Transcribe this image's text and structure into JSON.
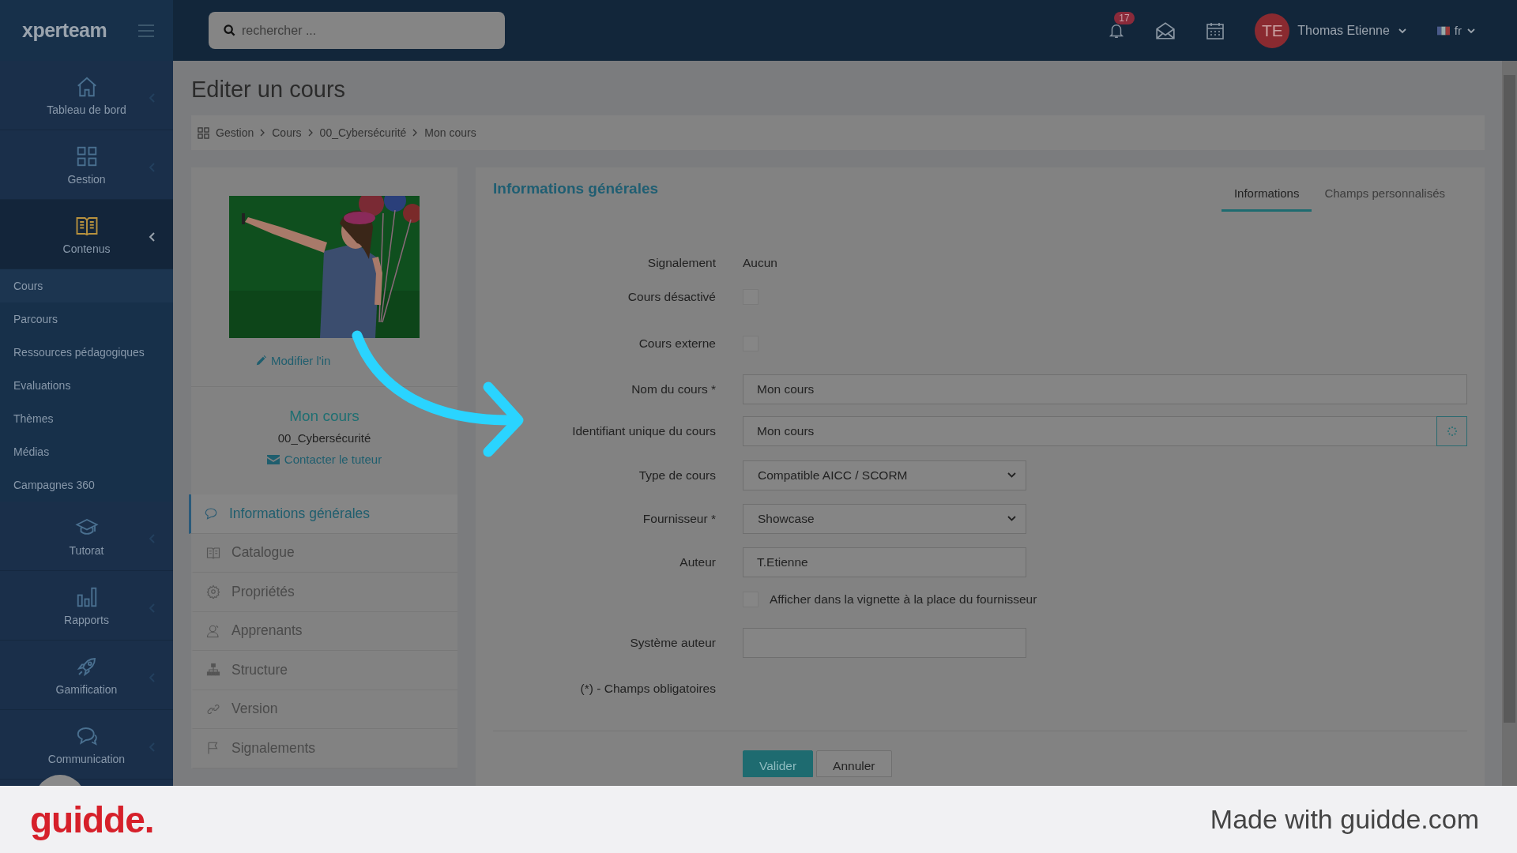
{
  "topbar": {
    "logo": "xperteam",
    "search": {
      "placeholder": "rechercher ..."
    },
    "notifications": "17",
    "user": {
      "initials": "TE",
      "name": "Thomas Etienne"
    },
    "language": "fr"
  },
  "sidebar": {
    "sections": [
      {
        "label": "Tableau de bord",
        "expanded": false
      },
      {
        "label": "Gestion",
        "expanded": false
      },
      {
        "label": "Contenus",
        "expanded": true,
        "children": [
          {
            "label": "Cours",
            "selected": true
          },
          {
            "label": "Parcours",
            "selected": false
          },
          {
            "label": "Ressources pédagogiques",
            "selected": false
          },
          {
            "label": "Evaluations",
            "selected": false
          },
          {
            "label": "Thèmes",
            "selected": false
          },
          {
            "label": "Médias",
            "selected": false
          },
          {
            "label": "Campagnes 360",
            "selected": false
          }
        ]
      },
      {
        "label": "Tutorat",
        "expanded": false
      },
      {
        "label": "Rapports",
        "expanded": false
      },
      {
        "label": "Gamification",
        "expanded": false
      },
      {
        "label": "Communication",
        "expanded": false
      }
    ]
  },
  "page": {
    "title": "Editer un cours",
    "breadcrumb": [
      "Gestion",
      "Cours",
      "00_Cybersécurité",
      "Mon cours"
    ]
  },
  "course_card": {
    "edit_image": "Modifier l'in",
    "name": "Mon cours",
    "theme": "00_Cybersécurité",
    "contact": "Contacter le tuteur",
    "menu": [
      {
        "label": "Informations générales",
        "selected": true
      },
      {
        "label": "Catalogue",
        "selected": false
      },
      {
        "label": "Propriétés",
        "selected": false
      },
      {
        "label": "Apprenants",
        "selected": false
      },
      {
        "label": "Structure",
        "selected": false
      },
      {
        "label": "Version",
        "selected": false
      },
      {
        "label": "Signalements",
        "selected": false
      }
    ]
  },
  "form": {
    "title": "Informations générales",
    "tabs": [
      {
        "label": "Informations",
        "selected": true
      },
      {
        "label": "Champs personnalisés",
        "selected": false
      }
    ],
    "rows": [
      {
        "kind": "text",
        "label": "Signalement",
        "value": "Aucun"
      },
      {
        "kind": "checkbox",
        "label": "Cours désactivé",
        "checked": false
      },
      {
        "kind": "checkbox",
        "label": "Cours externe",
        "checked": false
      },
      {
        "kind": "input",
        "label": "Nom du cours *",
        "value": "Mon cours"
      },
      {
        "kind": "input_button",
        "label": "Identifiant unique du cours",
        "value": "Mon cours"
      },
      {
        "kind": "select",
        "label": "Type de cours",
        "value": "Compatible AICC / SCORM"
      },
      {
        "kind": "select",
        "label": "Fournisseur *",
        "value": "Showcase"
      },
      {
        "kind": "short_input",
        "label": "Auteur",
        "value": "T.Etienne"
      },
      {
        "kind": "inline_checkbox",
        "text": "Afficher dans la vignette à la place du fournisseur",
        "checked": false
      },
      {
        "kind": "short_input",
        "label": "Système auteur"
      }
    ],
    "note": "(*) - Champs obligatoires",
    "buttons": [
      {
        "label": "Valider",
        "kind": "primary"
      },
      {
        "label": "Annuler",
        "kind": "secondary"
      }
    ]
  },
  "footer": {
    "brand": "guidde.",
    "credit": "Made with guidde.com"
  }
}
